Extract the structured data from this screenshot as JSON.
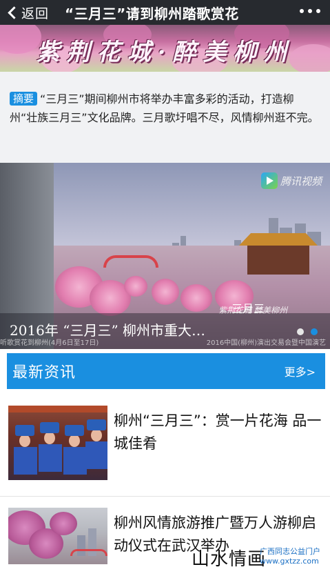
{
  "navbar": {
    "back_label": "返回",
    "title": "“三月三”请到柳州踏歌赏花"
  },
  "banner": {
    "text": "紫荆花城·醉美柳州"
  },
  "summary": {
    "tag": "摘要",
    "text": "“三月三”期间柳州市将举办丰富多彩的活动，打造柳州“壮族三月三”文化品牌。三月歌圩唱不尽，风情柳州逛不完。"
  },
  "hero": {
    "source_logo": "腾讯视频",
    "caption": "2016年 “三月三” 柳州市重大…",
    "sub_left": "听歌赏花到柳州(4月6日至17日)",
    "sub_right": "2016中国(柳州)演出交易会暨中国演艺",
    "watermark": "紫荆花城 醉美柳州",
    "image_text": "三月三",
    "slides": [
      {
        "active": false
      },
      {
        "active": true
      }
    ],
    "colors": {
      "dot_active": "#1a8fe0",
      "dot_inactive": "#e6e6e6"
    }
  },
  "section": {
    "title": "最新资讯",
    "more_label": "更多>"
  },
  "news": [
    {
      "title": "柳州“三月三”：赏一片花海 品一城佳肴"
    },
    {
      "title": "柳州风情旅游推广暨万人游柳启动仪式在武汉举办"
    }
  ],
  "watermark": {
    "text": "山水情画",
    "site_name": "广西同志公益门户",
    "site_url": "www.gxtzz.com"
  },
  "colors": {
    "navbar_bg": "#272a2f",
    "accent": "#1a8fe0",
    "summary_bg": "#f1f2f4"
  }
}
